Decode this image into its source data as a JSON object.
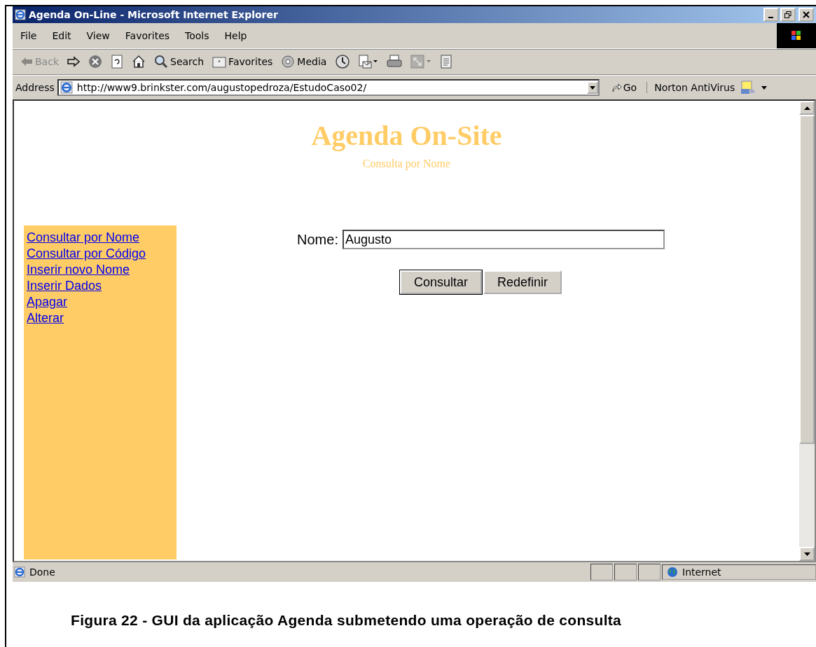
{
  "window": {
    "title": "Agenda On-Line - Microsoft Internet Explorer"
  },
  "menu": [
    "File",
    "Edit",
    "View",
    "Favorites",
    "Tools",
    "Help"
  ],
  "toolbar": [
    {
      "kind": "back",
      "label": "Back",
      "disabled": true
    },
    {
      "kind": "forward",
      "disabled": false
    },
    {
      "kind": "stop",
      "disabled": false
    },
    {
      "kind": "refresh",
      "disabled": false
    },
    {
      "kind": "home",
      "disabled": false
    },
    {
      "kind": "search",
      "label": "Search",
      "disabled": false
    },
    {
      "kind": "favorites",
      "label": "Favorites",
      "disabled": false
    },
    {
      "kind": "media",
      "label": "Media",
      "disabled": false
    },
    {
      "kind": "history",
      "disabled": false
    },
    {
      "kind": "mail",
      "disabled": false
    },
    {
      "kind": "print",
      "disabled": false
    },
    {
      "kind": "fullscreen",
      "disabled": true
    },
    {
      "kind": "edit",
      "disabled": false
    }
  ],
  "address": {
    "label": "Address",
    "url": "http://www9.brinkster.com/augustopedroza/EstudoCaso02/",
    "go": "Go",
    "plugin": "Norton AntiVirus"
  },
  "page": {
    "title": "Agenda On-Site",
    "subtitle": "Consulta por Nome",
    "nav": [
      "Consultar por Nome",
      "Consultar por Código",
      "Inserir novo Nome",
      "Inserir Dados",
      "Apagar",
      "Alterar"
    ],
    "field": {
      "label": "Nome:",
      "value": "Augusto"
    },
    "buttons": [
      {
        "label": "Consultar",
        "focused": true
      },
      {
        "label": "Redefinir",
        "focused": false
      }
    ]
  },
  "status_bar": {
    "text": "Done",
    "zone": "Internet"
  },
  "caption": "Figura 22 - GUI da aplicação Agenda submetendo uma operação de consulta"
}
